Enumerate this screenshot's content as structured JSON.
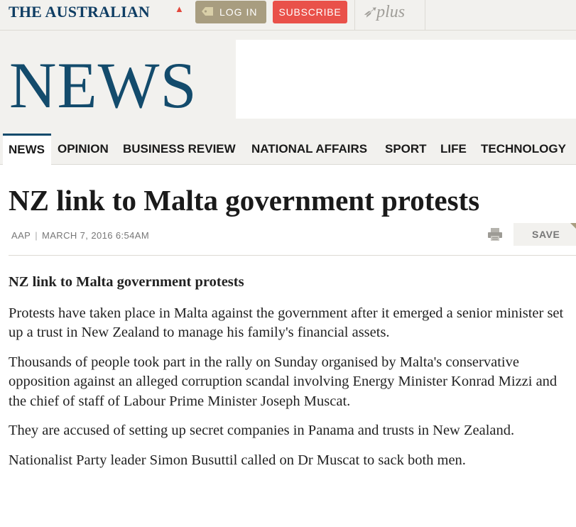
{
  "header": {
    "masthead": "THE AUSTRALIAN",
    "login_label": "LOG IN",
    "subscribe_label": "SUBSCRIBE",
    "plus_label": "plus"
  },
  "section": {
    "title": "NEWS"
  },
  "nav": {
    "items": [
      {
        "label": "NEWS",
        "active": true
      },
      {
        "label": "OPINION"
      },
      {
        "label": "BUSINESS REVIEW"
      },
      {
        "label": "NATIONAL AFFAIRS"
      },
      {
        "label": "SPORT"
      },
      {
        "label": "LIFE"
      },
      {
        "label": "TECHNOLOGY"
      }
    ]
  },
  "article": {
    "headline": "NZ link to Malta government protests",
    "source": "AAP",
    "date": "MARCH 7, 2016 6:54AM",
    "save_label": "SAVE",
    "subheading": "NZ link to Malta government protests",
    "paragraphs": [
      "Protests have taken place in Malta against the government after it emerged a senior minister set up a trust in New Zealand to manage his family's financial assets.",
      "Thousands of people took part in the rally on Sunday organised by Malta's conservative opposition against an alleged corruption scandal involving Energy Minister Konrad Mizzi and the chief of staff of Labour Prime Minister Joseph Muscat.",
      "They are accused of setting up secret companies in Panama and trusts in New Zealand.",
      "Nationalist Party leader Simon Busuttil called on Dr Muscat to sack both men."
    ]
  },
  "colors": {
    "brand_navy": "#134b6c",
    "subscribe_red": "#e9514a",
    "login_tan": "#a89d80",
    "band_bg": "#f2f1ee"
  },
  "icons": [
    "australia-map-icon",
    "tag-icon",
    "plus-logo",
    "print-icon"
  ]
}
